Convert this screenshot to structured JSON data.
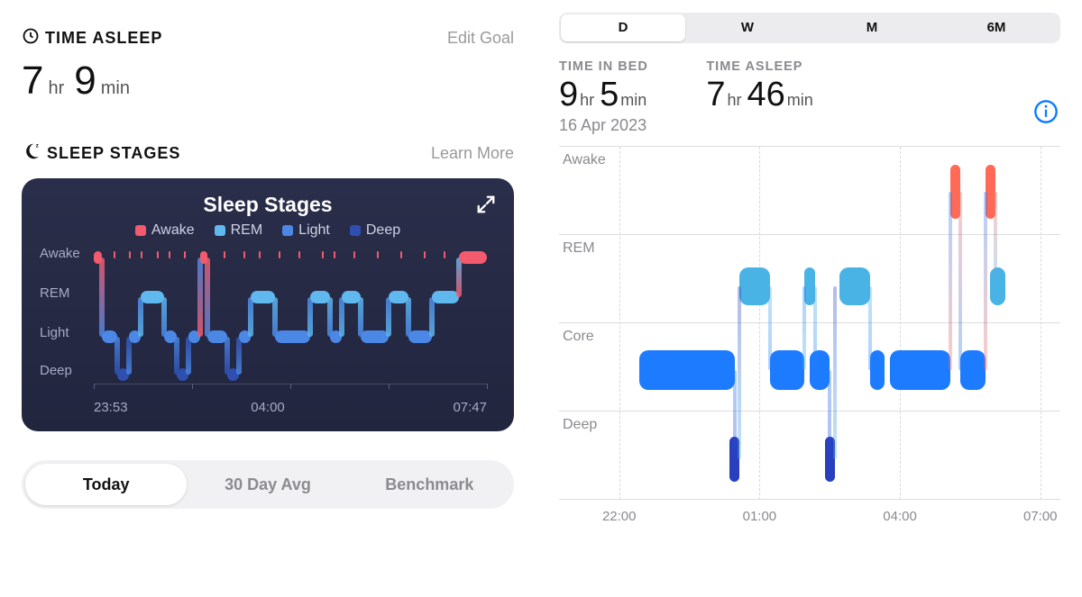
{
  "left": {
    "time_asleep_label": "TIME ASLEEP",
    "edit_goal": "Edit Goal",
    "time_asleep": {
      "hours": "7",
      "hr_unit": "hr",
      "minutes": "9",
      "min_unit": "min"
    },
    "sleep_stages_label": "SLEEP STAGES",
    "learn_more": "Learn More",
    "card": {
      "title": "Sleep Stages",
      "legend": {
        "awake": "Awake",
        "rem": "REM",
        "light": "Light",
        "deep": "Deep"
      },
      "y_labels": [
        "Awake",
        "REM",
        "Light",
        "Deep"
      ],
      "x_labels": [
        "23:53",
        "04:00",
        "07:47"
      ]
    },
    "segmented": {
      "today": "Today",
      "avg30": "30 Day Avg",
      "benchmark": "Benchmark",
      "active": "today"
    }
  },
  "right": {
    "segmented": {
      "d": "D",
      "w": "W",
      "m": "M",
      "m6": "6M",
      "active": "d"
    },
    "time_in_bed_label": "TIME IN BED",
    "time_asleep_label": "TIME ASLEEP",
    "time_in_bed": {
      "hours": "9",
      "hr_unit": "hr",
      "minutes": "5",
      "min_unit": "min"
    },
    "time_asleep": {
      "hours": "7",
      "hr_unit": "hr",
      "minutes": "46",
      "min_unit": "min"
    },
    "date": "16 Apr 2023",
    "rows": [
      "Awake",
      "REM",
      "Core",
      "Deep"
    ],
    "x_labels": [
      "22:00",
      "01:00",
      "04:00",
      "07:00"
    ]
  },
  "colors": {
    "awake": "#f45a6d",
    "rem": "#5fb8ee",
    "light": "#4b88e6",
    "deep": "#2f4fb0",
    "apple_awake": "#ff6a57",
    "apple_rem": "#49b3e6",
    "apple_core": "#1d7bff",
    "apple_deep": "#2a3fbd"
  },
  "chart_data": [
    {
      "type": "sleep-hypnogram",
      "source": "left-card",
      "title": "Sleep Stages",
      "stage_levels": [
        "Awake",
        "REM",
        "Light",
        "Deep"
      ],
      "x_range_hours": [
        "23:53",
        "07:47"
      ],
      "segments_pct": [
        {
          "stage": "Awake",
          "start": 0,
          "end": 2
        },
        {
          "stage": "Light",
          "start": 2,
          "end": 6
        },
        {
          "stage": "Deep",
          "start": 6,
          "end": 9
        },
        {
          "stage": "Light",
          "start": 9,
          "end": 12
        },
        {
          "stage": "REM",
          "start": 12,
          "end": 18
        },
        {
          "stage": "Light",
          "start": 18,
          "end": 21
        },
        {
          "stage": "Deep",
          "start": 21,
          "end": 24
        },
        {
          "stage": "Light",
          "start": 24,
          "end": 27
        },
        {
          "stage": "Awake",
          "start": 27,
          "end": 29
        },
        {
          "stage": "Light",
          "start": 29,
          "end": 34
        },
        {
          "stage": "Deep",
          "start": 34,
          "end": 37
        },
        {
          "stage": "Light",
          "start": 37,
          "end": 40
        },
        {
          "stage": "REM",
          "start": 40,
          "end": 46
        },
        {
          "stage": "Light",
          "start": 46,
          "end": 55
        },
        {
          "stage": "REM",
          "start": 55,
          "end": 60
        },
        {
          "stage": "Light",
          "start": 60,
          "end": 63
        },
        {
          "stage": "REM",
          "start": 63,
          "end": 68
        },
        {
          "stage": "Light",
          "start": 68,
          "end": 75
        },
        {
          "stage": "REM",
          "start": 75,
          "end": 80
        },
        {
          "stage": "Light",
          "start": 80,
          "end": 86
        },
        {
          "stage": "REM",
          "start": 86,
          "end": 93
        },
        {
          "stage": "Awake",
          "start": 93,
          "end": 100
        }
      ],
      "awake_ticks_pct": [
        5,
        9,
        12,
        16,
        19,
        23,
        33,
        38,
        42,
        47,
        52,
        58,
        61,
        66,
        72,
        78,
        84,
        89
      ]
    },
    {
      "type": "sleep-hypnogram",
      "source": "right-panel",
      "stage_levels": [
        "Awake",
        "REM",
        "Core",
        "Deep"
      ],
      "x_range_hours": [
        "22:00",
        "08:00"
      ],
      "segments_pct": [
        {
          "stage": "Core",
          "start": 16,
          "end": 35
        },
        {
          "stage": "Deep",
          "start": 34,
          "end": 36
        },
        {
          "stage": "REM",
          "start": 36,
          "end": 42
        },
        {
          "stage": "Core",
          "start": 42,
          "end": 49
        },
        {
          "stage": "REM",
          "start": 49,
          "end": 51
        },
        {
          "stage": "Core",
          "start": 50,
          "end": 54
        },
        {
          "stage": "Deep",
          "start": 53,
          "end": 55
        },
        {
          "stage": "REM",
          "start": 56,
          "end": 62
        },
        {
          "stage": "Core",
          "start": 62,
          "end": 65
        },
        {
          "stage": "Core",
          "start": 66,
          "end": 78
        },
        {
          "stage": "Awake",
          "start": 78,
          "end": 80
        },
        {
          "stage": "Core",
          "start": 80,
          "end": 85
        },
        {
          "stage": "Awake",
          "start": 85,
          "end": 87
        },
        {
          "stage": "REM",
          "start": 86,
          "end": 89
        }
      ]
    }
  ]
}
